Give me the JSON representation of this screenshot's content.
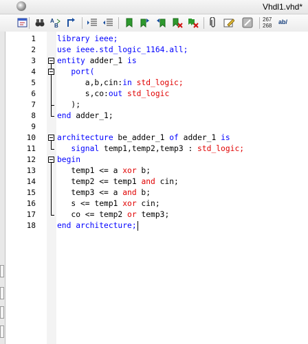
{
  "window": {
    "title": "Vhdl1.vhd*"
  },
  "toolbar": {
    "buttons": [
      {
        "name": "new-doc-icon"
      },
      {
        "name": "find-icon"
      },
      {
        "name": "replace-icon"
      },
      {
        "name": "goto-icon"
      },
      {
        "name": "indent-icon"
      },
      {
        "name": "unindent-icon"
      },
      {
        "name": "bookmark-toggle-icon"
      },
      {
        "name": "bookmark-next-icon"
      },
      {
        "name": "bookmark-prev-icon"
      },
      {
        "name": "bookmark-clear-icon"
      },
      {
        "name": "bookmark-clear-all-icon"
      },
      {
        "name": "clip-icon"
      },
      {
        "name": "edit-icon"
      },
      {
        "name": "tool-icon"
      }
    ],
    "coords_line1": "267",
    "coords_line2": "268",
    "ab_label": "ab/"
  },
  "editor": {
    "lines": [
      {
        "num": "1",
        "tokens": [
          {
            "t": "library ieee;",
            "c": "kw"
          }
        ]
      },
      {
        "num": "2",
        "tokens": [
          {
            "t": "use ieee.std_logic_1164.all;",
            "c": "kw"
          }
        ]
      },
      {
        "num": "3",
        "tokens": [
          {
            "t": "entity",
            "c": "kw"
          },
          {
            "t": " adder_1 ",
            "c": "plain"
          },
          {
            "t": "is",
            "c": "kw"
          }
        ]
      },
      {
        "num": "4",
        "tokens": [
          {
            "t": "   port(",
            "c": "kw"
          }
        ]
      },
      {
        "num": "5",
        "tokens": [
          {
            "t": "      a,b,cin:",
            "c": "plain"
          },
          {
            "t": "in",
            "c": "kw"
          },
          {
            "t": " std_logic;",
            "c": "op"
          }
        ]
      },
      {
        "num": "6",
        "tokens": [
          {
            "t": "      s,co:",
            "c": "plain"
          },
          {
            "t": "out",
            "c": "kw"
          },
          {
            "t": " std_logic",
            "c": "op"
          }
        ]
      },
      {
        "num": "7",
        "tokens": [
          {
            "t": "   );",
            "c": "plain"
          }
        ]
      },
      {
        "num": "8",
        "tokens": [
          {
            "t": "end",
            "c": "kw"
          },
          {
            "t": " adder_1;",
            "c": "plain"
          }
        ]
      },
      {
        "num": "9",
        "tokens": []
      },
      {
        "num": "10",
        "tokens": [
          {
            "t": "architecture",
            "c": "kw"
          },
          {
            "t": " be_adder_1 ",
            "c": "plain"
          },
          {
            "t": "of",
            "c": "kw"
          },
          {
            "t": " adder_1 ",
            "c": "plain"
          },
          {
            "t": "is",
            "c": "kw"
          }
        ]
      },
      {
        "num": "11",
        "tokens": [
          {
            "t": "   signal",
            "c": "kw"
          },
          {
            "t": " temp1,temp2,temp3 : ",
            "c": "plain"
          },
          {
            "t": "std_logic;",
            "c": "op"
          }
        ]
      },
      {
        "num": "12",
        "tokens": [
          {
            "t": "begin",
            "c": "kw"
          }
        ]
      },
      {
        "num": "13",
        "tokens": [
          {
            "t": "   temp1 <= a ",
            "c": "plain"
          },
          {
            "t": "xor",
            "c": "op"
          },
          {
            "t": " b;",
            "c": "plain"
          }
        ]
      },
      {
        "num": "14",
        "tokens": [
          {
            "t": "   temp2 <= temp1 ",
            "c": "plain"
          },
          {
            "t": "and",
            "c": "op"
          },
          {
            "t": " cin;",
            "c": "plain"
          }
        ]
      },
      {
        "num": "15",
        "tokens": [
          {
            "t": "   temp3 <= a ",
            "c": "plain"
          },
          {
            "t": "and",
            "c": "op"
          },
          {
            "t": " b;",
            "c": "plain"
          }
        ]
      },
      {
        "num": "16",
        "tokens": [
          {
            "t": "   s <= temp1 ",
            "c": "plain"
          },
          {
            "t": "xor",
            "c": "op"
          },
          {
            "t": " cin;",
            "c": "plain"
          }
        ]
      },
      {
        "num": "17",
        "tokens": [
          {
            "t": "   co <= temp2 ",
            "c": "plain"
          },
          {
            "t": "or",
            "c": "op"
          },
          {
            "t": " temp3;",
            "c": "plain"
          }
        ]
      },
      {
        "num": "18",
        "tokens": [
          {
            "t": "end architecture;",
            "c": "kw"
          }
        ]
      }
    ]
  }
}
